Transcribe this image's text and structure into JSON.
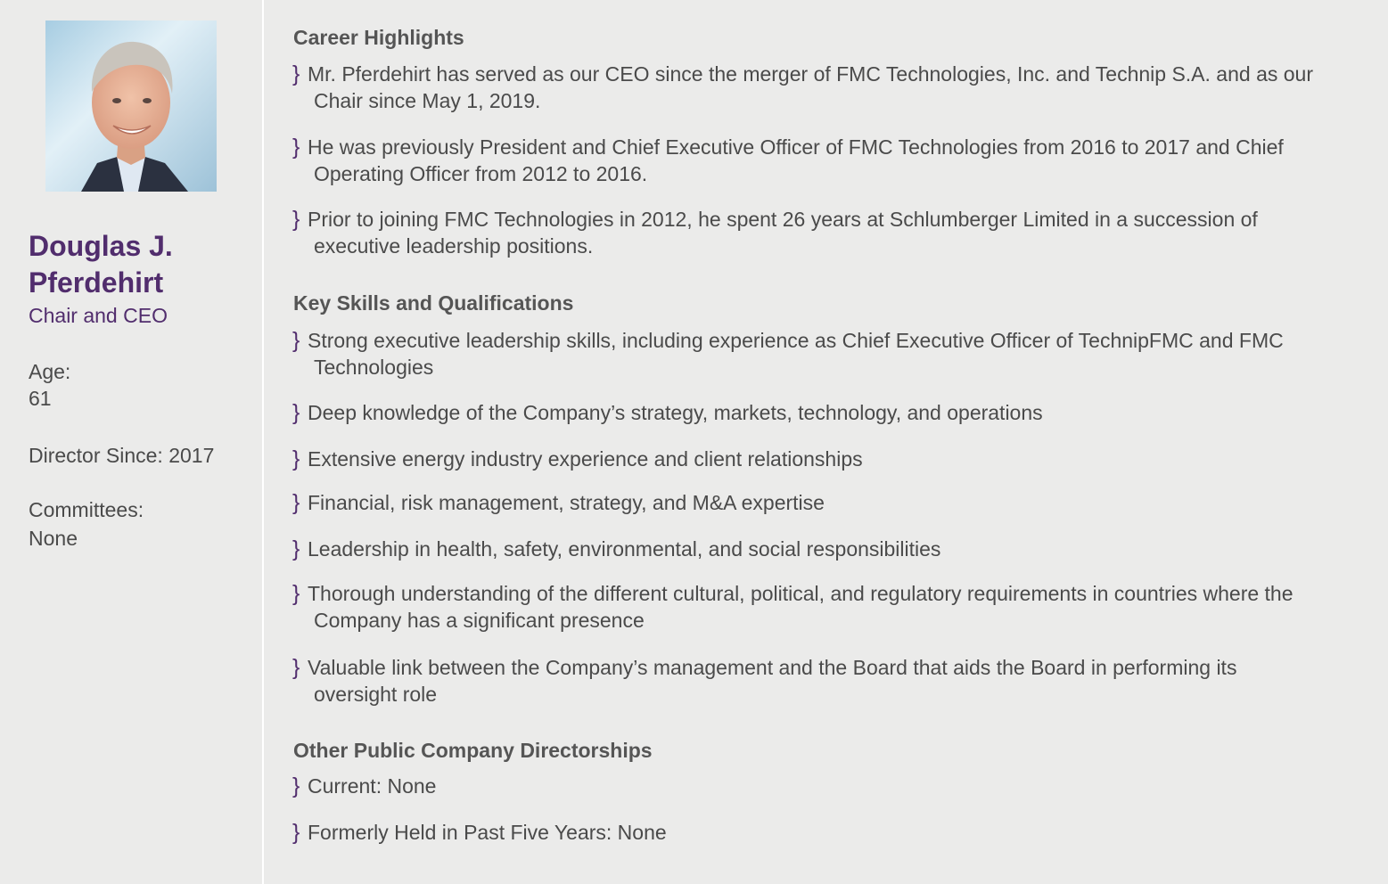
{
  "profile": {
    "name_line1": "Douglas J.",
    "name_line2": "Pferdehirt",
    "title": "Chair and CEO",
    "age_label": "Age:",
    "age_value": "61",
    "director_since": "Director Since: 2017",
    "committees_label": "Committees:",
    "committees_value": "None"
  },
  "career": {
    "heading": "Career Highlights",
    "items": [
      {
        "line1": "Mr. Pferdehirt has served as our CEO since the merger of FMC Technologies, Inc. and Technip S.A. and as our",
        "line2": "Chair since May 1, 2019."
      },
      {
        "line1": "He was previously President and Chief Executive Officer of FMC Technologies from 2016 to 2017 and Chief",
        "line2": "Operating Officer from 2012 to 2016."
      },
      {
        "line1": "Prior to joining FMC Technologies in 2012, he spent 26 years at Schlumberger Limited in a succession of",
        "line2": "executive leadership positions."
      }
    ]
  },
  "skills": {
    "heading": "Key Skills and Qualifications",
    "items": [
      {
        "line1": "Strong executive leadership skills, including experience as Chief Executive Officer of TechnipFMC and FMC",
        "line2": "Technologies"
      },
      {
        "line1": "Deep knowledge of the Company’s strategy, markets, technology, and operations"
      },
      {
        "line1": "Extensive energy industry experience and client relationships"
      },
      {
        "line1": "Financial, risk management, strategy, and M&A expertise"
      },
      {
        "line1": "Leadership in health, safety, environmental, and social responsibilities"
      },
      {
        "line1": "Thorough understanding of the different cultural, political, and regulatory requirements in countries where the",
        "line2": "Company has a significant presence"
      },
      {
        "line1": "Valuable link between the Company’s management and the Board that aids the Board in performing its",
        "line2": "oversight role"
      }
    ]
  },
  "directorships": {
    "heading": "Other Public Company Directorships",
    "items": [
      {
        "line1": "Current: None"
      },
      {
        "line1": "Formerly Held in Past Five Years: None"
      }
    ]
  },
  "bullet_glyph": "}",
  "colors": {
    "accent": "#512d6d",
    "body_text": "#4a4a4a",
    "background": "#ebebea"
  }
}
